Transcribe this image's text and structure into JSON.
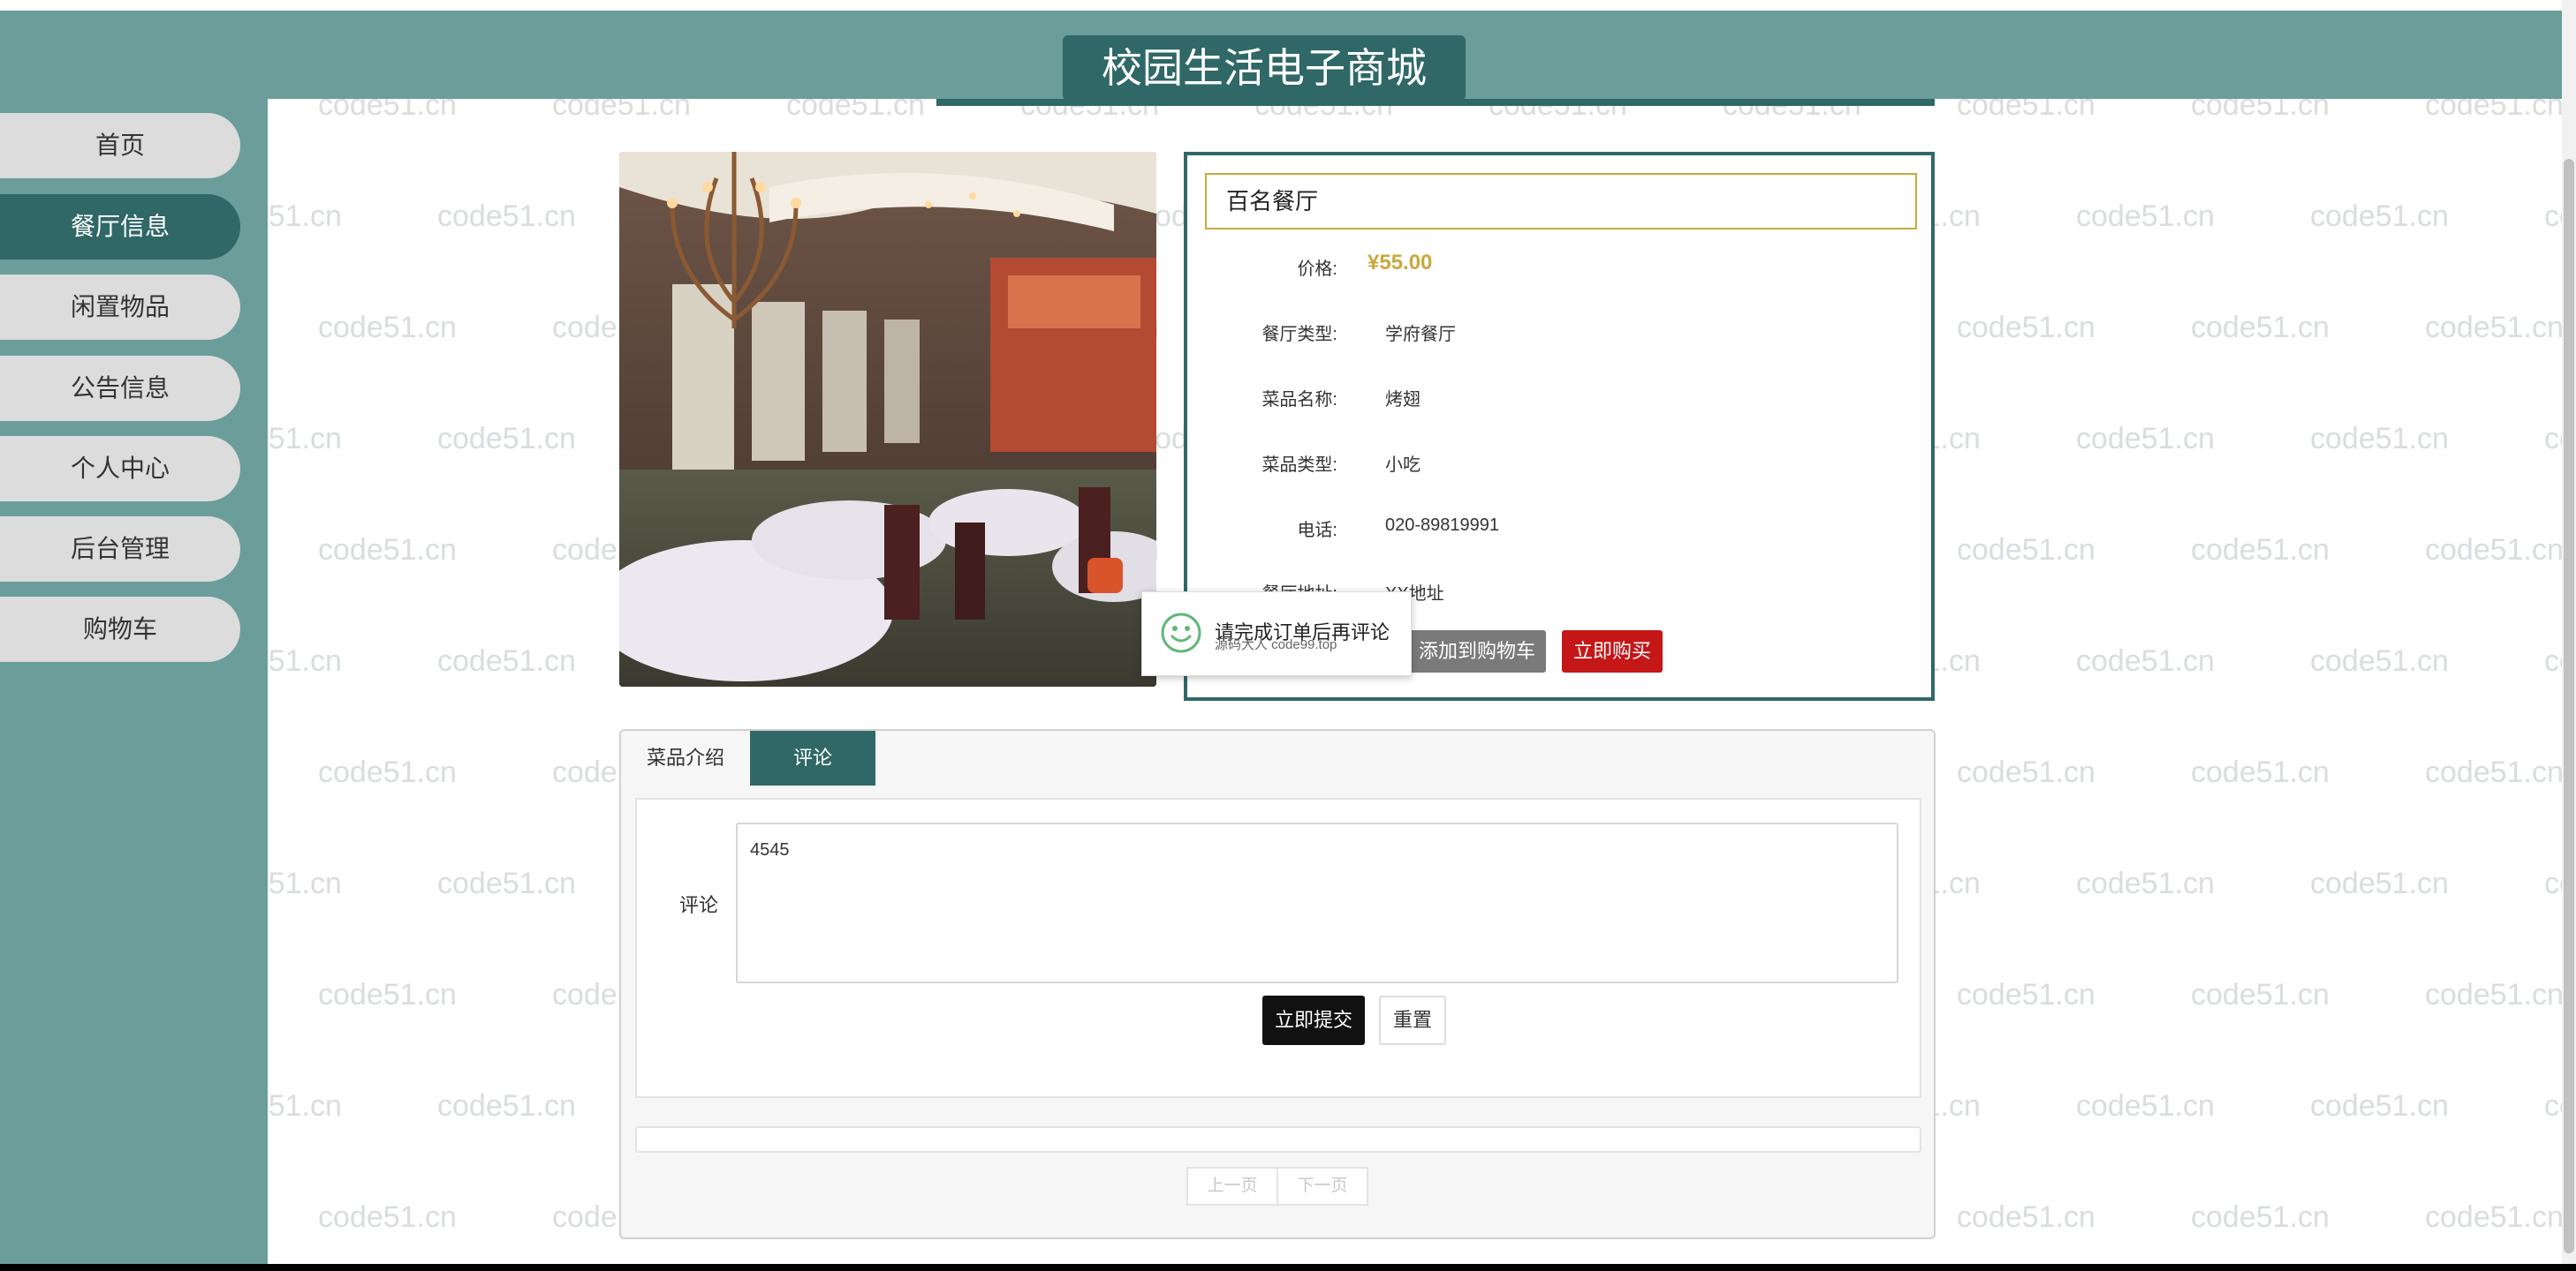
{
  "header": {
    "title": "校园生活电子商城"
  },
  "sidebar": {
    "items": [
      {
        "label": "首页",
        "active": false
      },
      {
        "label": "餐厅信息",
        "active": true
      },
      {
        "label": "闲置物品",
        "active": false
      },
      {
        "label": "公告信息",
        "active": false
      },
      {
        "label": "个人中心",
        "active": false
      },
      {
        "label": "后台管理",
        "active": false
      },
      {
        "label": "购物车",
        "active": false
      }
    ]
  },
  "product": {
    "name": "百名餐厅",
    "price_label": "价格:",
    "price": "¥55.00",
    "fields": [
      {
        "label": "餐厅类型:",
        "value": "学府餐厅"
      },
      {
        "label": "菜品名称:",
        "value": "烤翅"
      },
      {
        "label": "菜品类型:",
        "value": "小吃"
      },
      {
        "label": "电话:",
        "value": "020-89819991"
      },
      {
        "label": "餐厅地址:",
        "value": "XX地址"
      }
    ],
    "add_to_cart": "添加到购物车",
    "buy_now": "立即购买"
  },
  "toast": {
    "message": "请完成订单后再评论",
    "sub": "源码大人 code99.top"
  },
  "tabs": [
    {
      "label": "菜品介绍",
      "active": false
    },
    {
      "label": "评论",
      "active": true
    }
  ],
  "comment": {
    "label": "评论",
    "value": "4545",
    "submit": "立即提交",
    "reset": "重置"
  },
  "pager": {
    "prev": "上一页",
    "next": "下一页"
  },
  "watermark": "code51.cn",
  "colors": {
    "primary": "#2f6866",
    "sidebar": "#6b9d9b",
    "price": "#c9a93d",
    "buy": "#c51618"
  }
}
